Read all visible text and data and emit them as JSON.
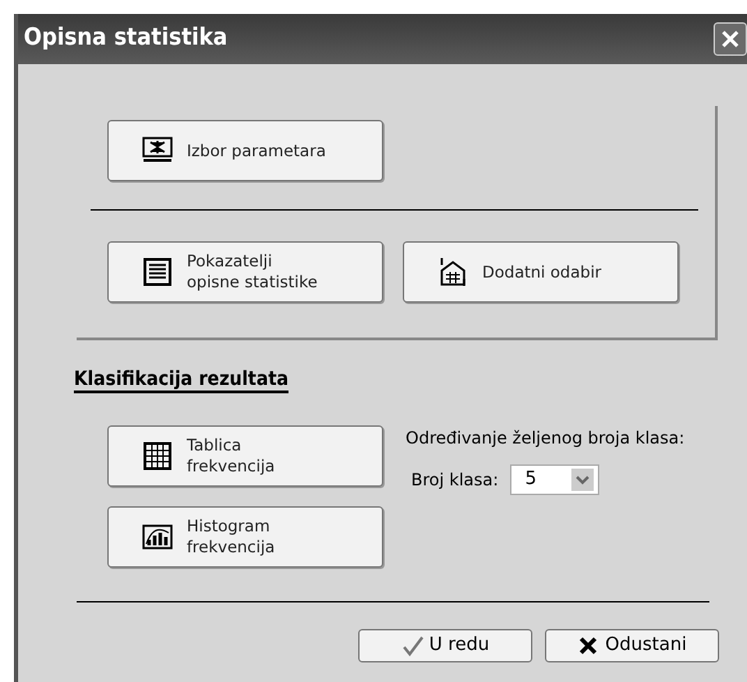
{
  "window": {
    "title": "Opisna statistika"
  },
  "top_buttons": [
    {
      "label": "Izbor parametara",
      "kind": "params"
    }
  ],
  "middle_buttons": [
    {
      "label": "Pokazatelji\nopisne statistike",
      "kind": "list"
    },
    {
      "label": "Dodatni odabir",
      "kind": "extra"
    }
  ],
  "classification": {
    "heading": "Klasifikacija rezultata",
    "buttons": [
      {
        "label": "Tablica\nfrekvencija",
        "kind": "table"
      },
      {
        "label": "Histogram\nfrekvencija",
        "kind": "histogram"
      }
    ],
    "prompt": "Određivanje željenog broja klasa:",
    "class_count": {
      "label": "Broj klasa:",
      "value": "5"
    }
  },
  "dialog_buttons": [
    {
      "label": "U redu",
      "kind": "confirm"
    },
    {
      "label": "Odustani",
      "kind": "cancel"
    }
  ]
}
